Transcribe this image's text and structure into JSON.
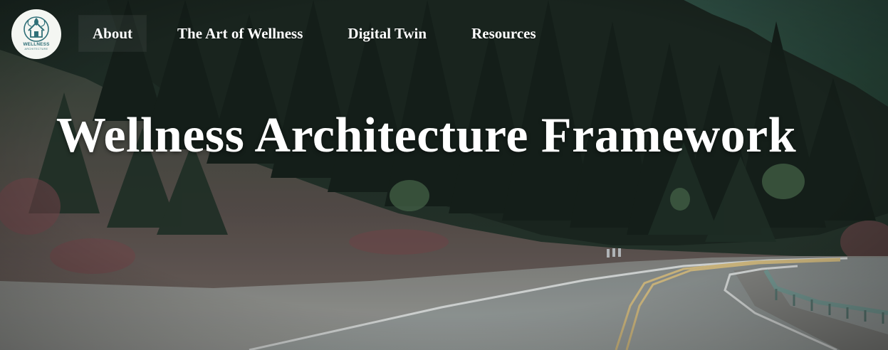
{
  "site": {
    "logo_icon": "wellness-house-lotus-icon",
    "logo_text": "WELLNESS",
    "logo_subtext": "ARCHITECTURE"
  },
  "nav": {
    "items": [
      {
        "label": "About",
        "active": true
      },
      {
        "label": "The Art of Wellness",
        "active": false
      },
      {
        "label": "Digital Twin",
        "active": false
      },
      {
        "label": "Resources",
        "active": false
      }
    ]
  },
  "hero": {
    "title": "Wellness Architecture Framework",
    "background": "forest-mountain-road-photo"
  },
  "colors": {
    "nav_text": "#ffffff",
    "title_text": "#ffffff",
    "logo_accent": "#2f6f77",
    "logo_bg": "#f4f6f2"
  }
}
